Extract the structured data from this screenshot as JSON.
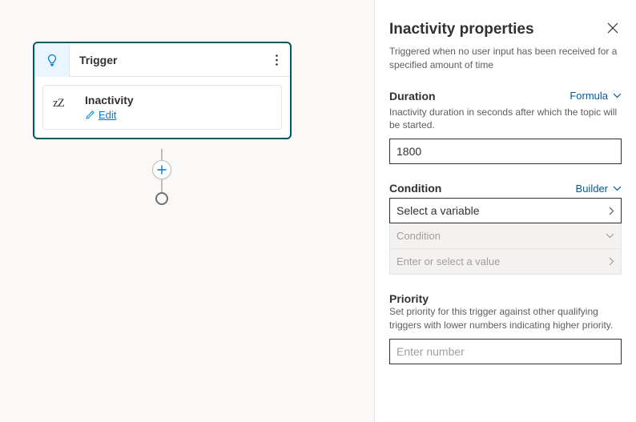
{
  "canvas": {
    "trigger": {
      "header_label": "Trigger",
      "action_title": "Inactivity",
      "edit_label": "Edit",
      "icon_glyph": "zZ"
    }
  },
  "panel": {
    "title": "Inactivity properties",
    "subtitle": "Triggered when no user input has been received for a specified amount of time",
    "duration": {
      "label": "Duration",
      "mode": "Formula",
      "desc": "Inactivity duration in seconds after which the topic will be started.",
      "value": "1800"
    },
    "condition": {
      "label": "Condition",
      "mode": "Builder",
      "select_variable": "Select a variable",
      "operator_placeholder": "Condition",
      "value_placeholder": "Enter or select a value"
    },
    "priority": {
      "label": "Priority",
      "desc": "Set priority for this trigger against other qualifying triggers with lower numbers indicating higher priority.",
      "placeholder": "Enter number",
      "value": ""
    }
  }
}
